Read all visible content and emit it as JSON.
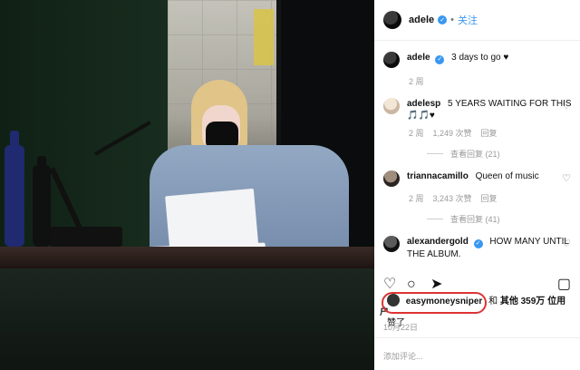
{
  "header": {
    "username": "adele",
    "follow": "关注"
  },
  "post": {
    "caption_user": "adele",
    "caption_text": "3 days to go ♥",
    "caption_time": "2 周"
  },
  "comments": [
    {
      "user": "adelesp",
      "text": "5 YEARS WAITING FOR THIS 🎵🎵♥",
      "time": "2 周",
      "likes": "1,249 次赞",
      "reply": "回复",
      "view_replies": "查看回复 (21)"
    },
    {
      "user": "triannacamillo",
      "text": "Queen of music",
      "time": "2 周",
      "likes": "3,243 次赞",
      "reply": "回复",
      "view_replies": "查看回复 (41)"
    },
    {
      "user": "alexandergold",
      "text": "HOW MANY UNTIL THE ALBUM."
    }
  ],
  "likes_line": {
    "user": "easymoneysniper",
    "text1": "和",
    "text2": "其他 359万 位用户",
    "text3": "赞了"
  },
  "date": "10月22日",
  "comment_placeholder": "添加评论..."
}
